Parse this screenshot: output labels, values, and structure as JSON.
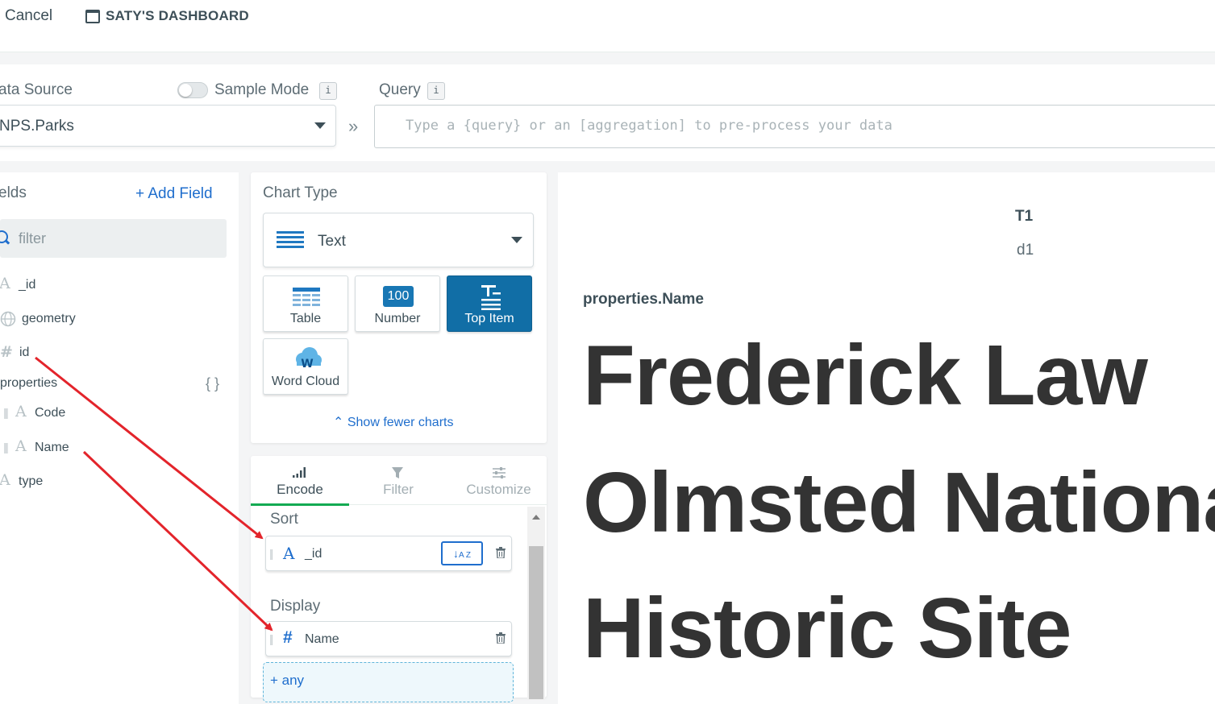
{
  "topbar": {
    "cancel": "Cancel",
    "dashboard_title": "SATY'S DASHBOARD"
  },
  "datasource": {
    "label": "ata Source",
    "sample_mode_label": "Sample Mode",
    "info_glyph": "i",
    "selected": "NPS.Parks",
    "query_label": "Query",
    "query_placeholder": "Type a {query} or an [aggregation] to pre-process your data",
    "chevron": "»"
  },
  "fields": {
    "title": "elds",
    "add_field": "+ Add Field",
    "filter_placeholder": "filter",
    "items": [
      {
        "icon": "A",
        "label": "_id"
      },
      {
        "icon": "globe",
        "label": "geometry"
      },
      {
        "icon": "#",
        "label": "id"
      },
      {
        "icon": "",
        "label": "properties",
        "badge": "{ }"
      },
      {
        "icon": "A",
        "label": "Code"
      },
      {
        "icon": "A",
        "label": "Name"
      },
      {
        "icon": "A",
        "label": "type"
      }
    ]
  },
  "chart_type": {
    "title": "Chart Type",
    "selected": "Text",
    "tiles": [
      {
        "label": "Table"
      },
      {
        "label": "Number",
        "badge": "100"
      },
      {
        "label": "Top Item",
        "active": true
      },
      {
        "label": "Word Cloud",
        "badge": "W"
      }
    ],
    "show_fewer": "Show fewer charts"
  },
  "encode": {
    "tabs": [
      "Encode",
      "Filter",
      "Customize"
    ],
    "sort_title": "Sort",
    "sort_field": "_id",
    "sort_icon": "A",
    "display_title": "Display",
    "display_field": "Name",
    "display_icon": "#",
    "any": "+ any"
  },
  "preview": {
    "t1": "T1",
    "d1": "d1",
    "prop_name": "properties.Name",
    "lines": [
      "Frederick Law",
      "Olmsted National",
      "Historic Site"
    ]
  },
  "colors": {
    "accent": "#1f6ecd",
    "active_tile": "#116ea6",
    "tab_green": "#13aa52",
    "annotation": "#e3242b"
  }
}
